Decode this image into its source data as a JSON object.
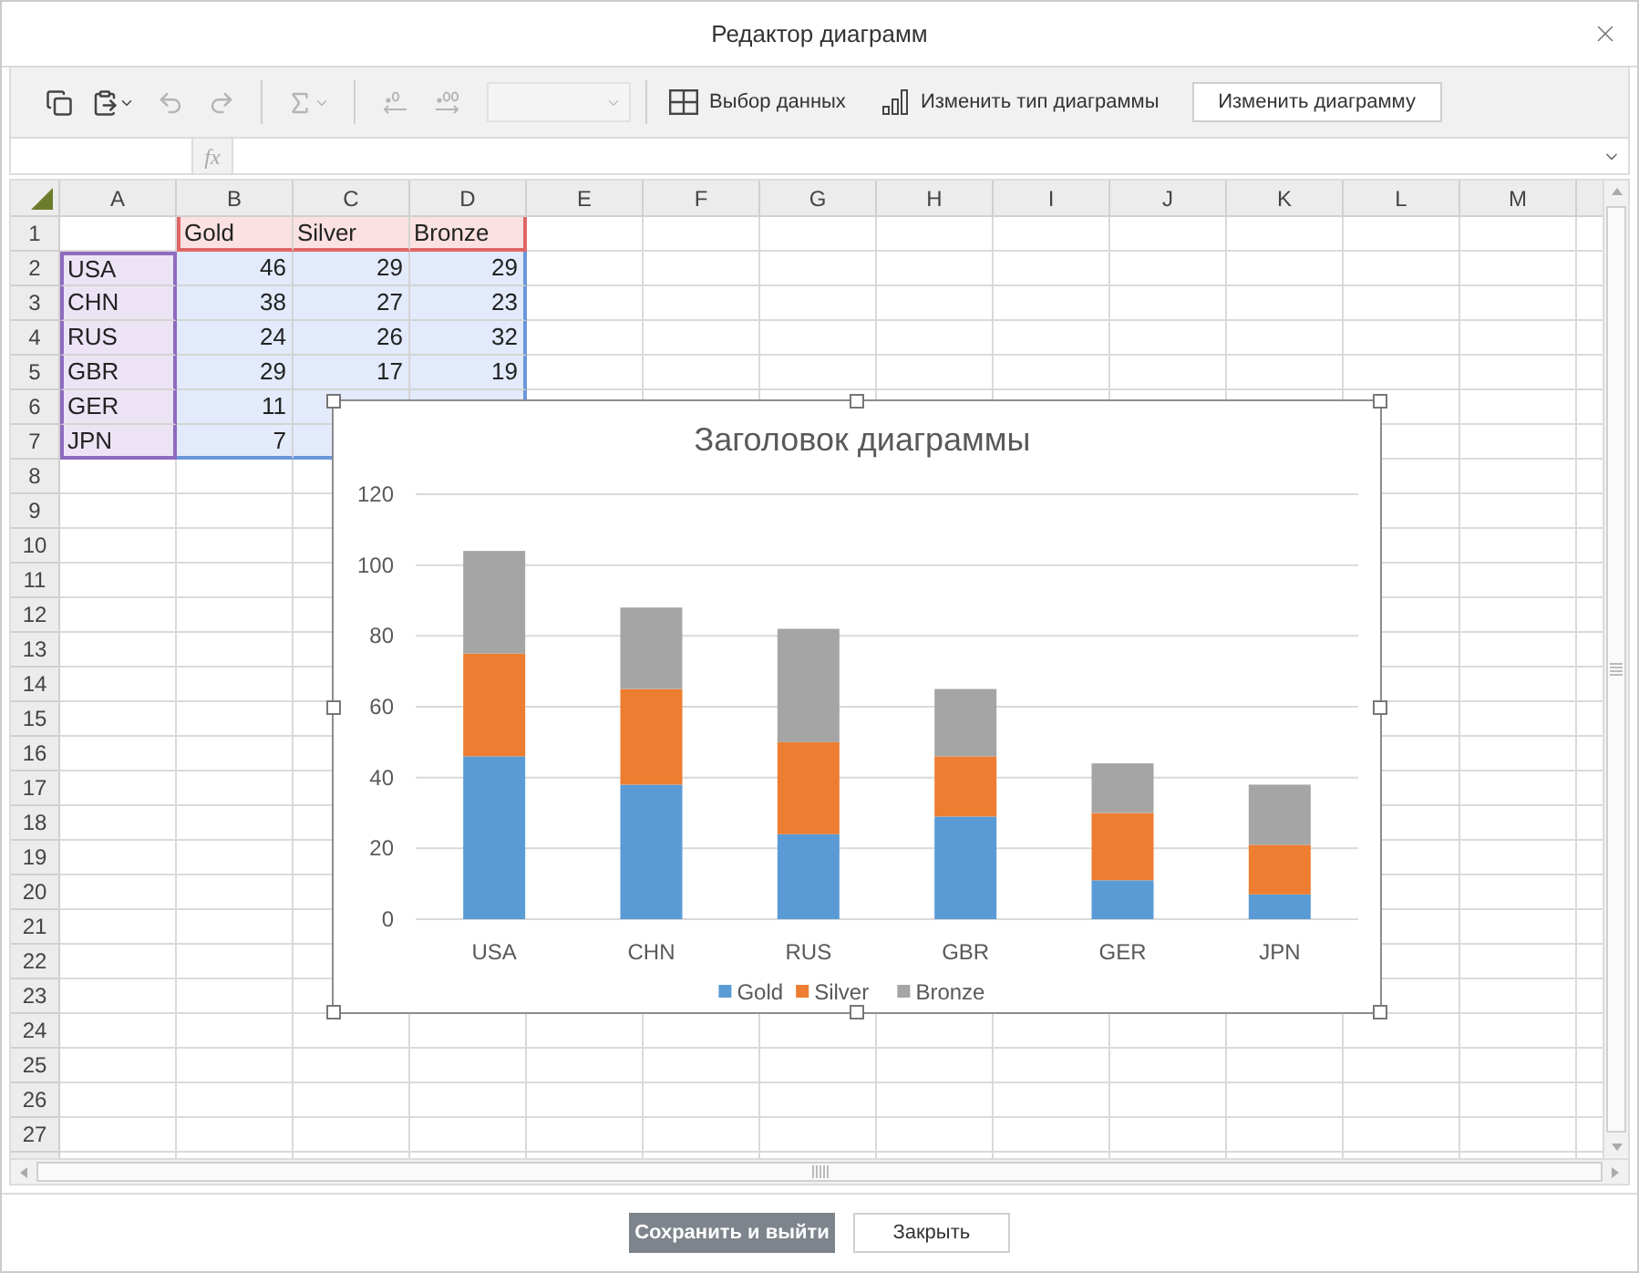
{
  "dialog": {
    "title": "Редактор диаграмм"
  },
  "toolbar": {
    "tools": [
      {
        "kind": "copy",
        "disabled": false
      },
      {
        "kind": "paste",
        "disabled": false
      },
      {
        "kind": "undo",
        "disabled": true
      },
      {
        "kind": "redo",
        "disabled": true
      },
      {
        "kind": "separator"
      },
      {
        "kind": "sum",
        "disabled": true
      },
      {
        "kind": "separator"
      },
      {
        "kind": "decrease_decimals",
        "disabled": true
      },
      {
        "kind": "increase_decimals",
        "disabled": true
      },
      {
        "kind": "format_select",
        "disabled": true
      },
      {
        "kind": "separator"
      }
    ],
    "select_data": "Выбор данных",
    "change_type": "Изменить тип диаграммы",
    "edit_chart": "Изменить диаграмму"
  },
  "formula_bar": {
    "fx": "fx"
  },
  "sheet": {
    "columns": [
      "A",
      "B",
      "C",
      "D",
      "E",
      "F",
      "G",
      "H",
      "I",
      "J",
      "K",
      "L",
      "M"
    ],
    "row_numbers": [
      "1",
      "2",
      "3",
      "4",
      "5",
      "6",
      "7",
      "8",
      "9",
      "10",
      "11",
      "12",
      "13",
      "14",
      "15",
      "16",
      "17",
      "18",
      "19",
      "20",
      "21",
      "22",
      "23",
      "24",
      "25",
      "26",
      "27"
    ],
    "series_header": [
      "Gold",
      "Silver",
      "Bronze"
    ],
    "rows": [
      {
        "label": "USA",
        "values": [
          "46",
          "29",
          "29"
        ]
      },
      {
        "label": "CHN",
        "values": [
          "38",
          "27",
          "23"
        ]
      },
      {
        "label": "RUS",
        "values": [
          "24",
          "26",
          "32"
        ]
      },
      {
        "label": "GBR",
        "values": [
          "29",
          "17",
          "19"
        ]
      },
      {
        "label": "GER",
        "values": [
          "11"
        ]
      },
      {
        "label": "JPN",
        "values": [
          "7"
        ]
      }
    ]
  },
  "chart": {
    "chart_data": {
      "type": "bar",
      "stacked": true,
      "title": "Заголовок диаграммы",
      "categories": [
        "USA",
        "CHN",
        "RUS",
        "GBR",
        "GER",
        "JPN"
      ],
      "series": [
        {
          "name": "Gold",
          "color": "#5b9bd5",
          "values": [
            46,
            38,
            24,
            29,
            11,
            7
          ]
        },
        {
          "name": "Silver",
          "color": "#ed7d31",
          "values": [
            29,
            27,
            26,
            17,
            19,
            14
          ]
        },
        {
          "name": "Bronze",
          "color": "#a5a5a5",
          "values": [
            29,
            23,
            32,
            19,
            14,
            17
          ]
        }
      ],
      "ylim": [
        0,
        120
      ],
      "yticks": [
        0,
        20,
        40,
        60,
        80,
        100,
        120
      ],
      "grid": true,
      "legend": true
    }
  },
  "buttons": [
    {
      "label": "Сохранить и выйти",
      "kind": "primary"
    },
    {
      "label": "Закрыть",
      "kind": "secondary"
    }
  ]
}
